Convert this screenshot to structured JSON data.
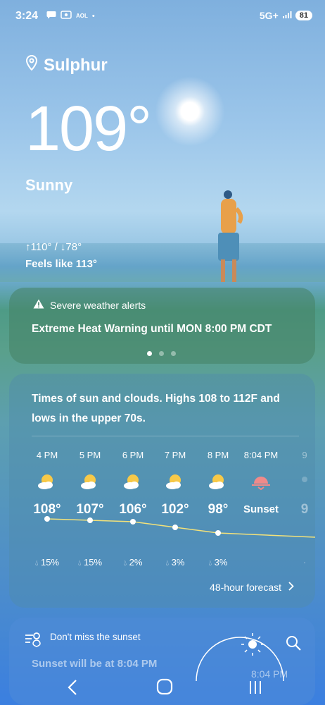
{
  "status": {
    "time": "3:24",
    "left_icons": [
      "chat-icon",
      "screen-record-icon",
      "AOL",
      "•"
    ],
    "network": "5G+",
    "battery": "81"
  },
  "weather": {
    "location": "Sulphur",
    "temperature": "109°",
    "condition": "Sunny",
    "hi_lo": "↑110° / ↓78°",
    "feels_like": "Feels like 113°"
  },
  "alert": {
    "title": "Severe weather alerts",
    "text": "Extreme Heat Warning until MON 8:00 PM CDT",
    "page_index": 0,
    "page_count": 3
  },
  "forecast": {
    "summary": "Times of sun and clouds. Highs 108 to 112F and lows in the upper 70s.",
    "hours": [
      {
        "time": "4 PM",
        "icon": "partly-sunny-icon",
        "temp": "108°",
        "value": 108,
        "precip": "15%"
      },
      {
        "time": "5 PM",
        "icon": "partly-sunny-icon",
        "temp": "107°",
        "value": 107,
        "precip": "15%"
      },
      {
        "time": "6 PM",
        "icon": "partly-sunny-icon",
        "temp": "106°",
        "value": 106,
        "precip": "2%"
      },
      {
        "time": "7 PM",
        "icon": "partly-sunny-icon",
        "temp": "102°",
        "value": 102,
        "precip": "3%"
      },
      {
        "time": "8 PM",
        "icon": "partly-sunny-icon",
        "temp": "98°",
        "value": 98,
        "precip": "3%"
      },
      {
        "time": "8:04 PM",
        "icon": "sunset-icon",
        "temp": "Sunset",
        "value": null,
        "precip": ""
      },
      {
        "time": "9",
        "icon": "moon-icon",
        "temp": "9",
        "value": null,
        "precip": ""
      }
    ],
    "link": "48-hour forecast"
  },
  "sunset": {
    "label": "Don't miss the sunset",
    "text": "Sunset will be at 8:04 PM",
    "time": "8:04 PM"
  },
  "colors": {
    "accent_sun": "#f7c948",
    "sunset_pink": "#f08a8a",
    "chart_line": "#f3e27a"
  }
}
